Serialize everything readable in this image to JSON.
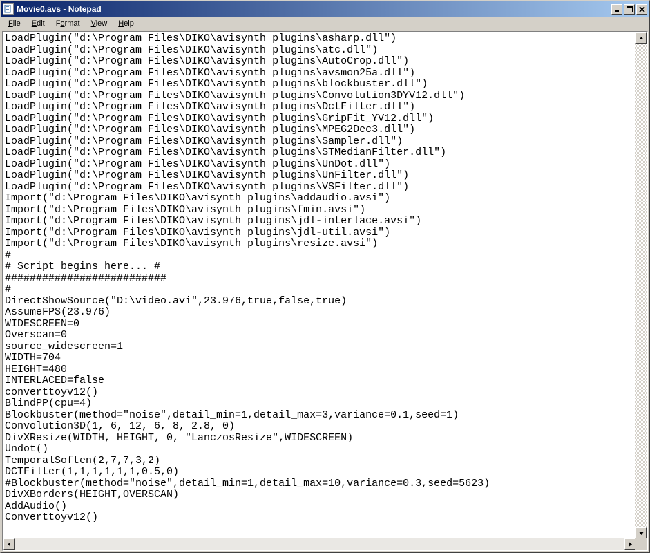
{
  "window": {
    "title": "Movie0.avs - Notepad"
  },
  "menu": {
    "file": "File",
    "edit": "Edit",
    "format": "Format",
    "view": "View",
    "help": "Help"
  },
  "editor": {
    "content": "LoadPlugin(\"d:\\Program Files\\DIKO\\avisynth plugins\\asharp.dll\")\nLoadPlugin(\"d:\\Program Files\\DIKO\\avisynth plugins\\atc.dll\")\nLoadPlugin(\"d:\\Program Files\\DIKO\\avisynth plugins\\AutoCrop.dll\")\nLoadPlugin(\"d:\\Program Files\\DIKO\\avisynth plugins\\avsmon25a.dll\")\nLoadPlugin(\"d:\\Program Files\\DIKO\\avisynth plugins\\blockbuster.dll\")\nLoadPlugin(\"d:\\Program Files\\DIKO\\avisynth plugins\\Convolution3DYV12.dll\")\nLoadPlugin(\"d:\\Program Files\\DIKO\\avisynth plugins\\DctFilter.dll\")\nLoadPlugin(\"d:\\Program Files\\DIKO\\avisynth plugins\\GripFit_YV12.dll\")\nLoadPlugin(\"d:\\Program Files\\DIKO\\avisynth plugins\\MPEG2Dec3.dll\")\nLoadPlugin(\"d:\\Program Files\\DIKO\\avisynth plugins\\Sampler.dll\")\nLoadPlugin(\"d:\\Program Files\\DIKO\\avisynth plugins\\STMedianFilter.dll\")\nLoadPlugin(\"d:\\Program Files\\DIKO\\avisynth plugins\\UnDot.dll\")\nLoadPlugin(\"d:\\Program Files\\DIKO\\avisynth plugins\\UnFilter.dll\")\nLoadPlugin(\"d:\\Program Files\\DIKO\\avisynth plugins\\VSFilter.dll\")\nImport(\"d:\\Program Files\\DIKO\\avisynth plugins\\addaudio.avsi\")\nImport(\"d:\\Program Files\\DIKO\\avisynth plugins\\fmin.avsi\")\nImport(\"d:\\Program Files\\DIKO\\avisynth plugins\\jdl-interlace.avsi\")\nImport(\"d:\\Program Files\\DIKO\\avisynth plugins\\jdl-util.avsi\")\nImport(\"d:\\Program Files\\DIKO\\avisynth plugins\\resize.avsi\")\n#\n# Script begins here... #\n##########################\n#\nDirectShowSource(\"D:\\video.avi\",23.976,true,false,true)\nAssumeFPS(23.976)\nWIDESCREEN=0\nOverscan=0\nsource_widescreen=1\nWIDTH=704\nHEIGHT=480\nINTERLACED=false\nconverttoyv12()\nBlindPP(cpu=4)\nBlockbuster(method=\"noise\",detail_min=1,detail_max=3,variance=0.1,seed=1)\nConvolution3D(1, 6, 12, 6, 8, 2.8, 0)\nDivXResize(WIDTH, HEIGHT, 0, \"LanczosResize\",WIDESCREEN)\nUndot()\nTemporalSoften(2,7,7,3,2)\nDCTFilter(1,1,1,1,1,1,0.5,0)\n#Blockbuster(method=\"noise\",detail_min=1,detail_max=10,variance=0.3,seed=5623)\nDivXBorders(HEIGHT,OVERSCAN)\nAddAudio()\nConverttoyv12()"
  }
}
